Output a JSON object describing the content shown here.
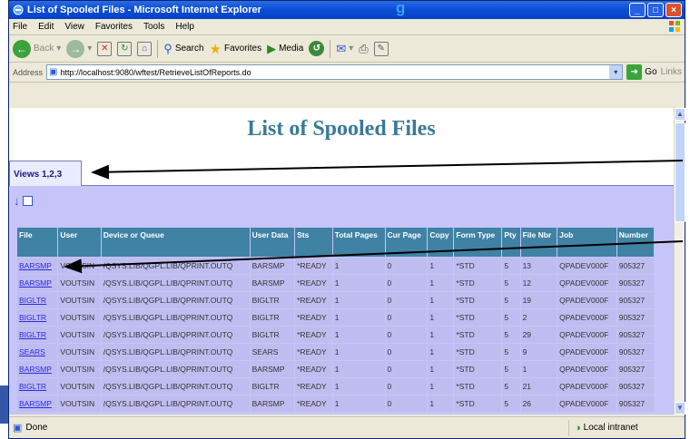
{
  "behind_title_fragment": "g",
  "window": {
    "title": "List of Spooled Files - Microsoft Internet Explorer",
    "buttons": {
      "minimize": "_",
      "maximize": "□",
      "close": "×"
    }
  },
  "menu": [
    "File",
    "Edit",
    "View",
    "Favorites",
    "Tools",
    "Help"
  ],
  "toolbar": {
    "back": "Back",
    "search": "Search",
    "favorites": "Favorites",
    "media": "Media"
  },
  "address": {
    "label": "Address",
    "url": "http://localhost:9080/wftest/RetrieveListOfReports.do",
    "go": "Go",
    "links": "Links"
  },
  "page": {
    "title": "List of Spooled Files",
    "tab_label": "Views 1,2,3"
  },
  "table": {
    "headers": [
      "File",
      "User",
      "Device or Queue",
      "User Data",
      "Sts",
      "Total Pages",
      "Cur Page",
      "Copy",
      "Form Type",
      "Pty",
      "File Nbr",
      "Job",
      "Number"
    ],
    "rows": [
      [
        "BARSMP",
        "VOUTSIN",
        "/QSYS.LIB/QGPL.LIB/QPRINT.OUTQ",
        "BARSMP",
        "*READY",
        "1",
        "0",
        "1",
        "*STD",
        "5",
        "13",
        "QPADEV000F",
        "905327"
      ],
      [
        "BARSMP",
        "VOUTSIN",
        "/QSYS.LIB/QGPL.LIB/QPRINT.OUTQ",
        "BARSMP",
        "*READY",
        "1",
        "0",
        "1",
        "*STD",
        "5",
        "12",
        "QPADEV000F",
        "905327"
      ],
      [
        "BIGLTR",
        "VOUTSIN",
        "/QSYS.LIB/QGPL.LIB/QPRINT.OUTQ",
        "BIGLTR",
        "*READY",
        "1",
        "0",
        "1",
        "*STD",
        "5",
        "19",
        "QPADEV000F",
        "905327"
      ],
      [
        "BIGLTR",
        "VOUTSIN",
        "/QSYS.LIB/QGPL.LIB/QPRINT.OUTQ",
        "BIGLTR",
        "*READY",
        "1",
        "0",
        "1",
        "*STD",
        "5",
        "2",
        "QPADEV000F",
        "905327"
      ],
      [
        "BIGLTR",
        "VOUTSIN",
        "/QSYS.LIB/QGPL.LIB/QPRINT.OUTQ",
        "BIGLTR",
        "*READY",
        "1",
        "0",
        "1",
        "*STD",
        "5",
        "29",
        "QPADEV000F",
        "905327"
      ],
      [
        "SEARS",
        "VOUTSIN",
        "/QSYS.LIB/QGPL.LIB/QPRINT.OUTQ",
        "SEARS",
        "*READY",
        "1",
        "0",
        "1",
        "*STD",
        "5",
        "9",
        "QPADEV000F",
        "905327"
      ],
      [
        "BARSMP",
        "VOUTSIN",
        "/QSYS.LIB/QGPL.LIB/QPRINT.OUTQ",
        "BARSMP",
        "*READY",
        "1",
        "0",
        "1",
        "*STD",
        "5",
        "1",
        "QPADEV000F",
        "905327"
      ],
      [
        "BIGLTR",
        "VOUTSIN",
        "/QSYS.LIB/QGPL.LIB/QPRINT.OUTQ",
        "BIGLTR",
        "*READY",
        "1",
        "0",
        "1",
        "*STD",
        "5",
        "21",
        "QPADEV000F",
        "905327"
      ],
      [
        "BARSMP",
        "VOUTSIN",
        "/QSYS.LIB/QGPL.LIB/QPRINT.OUTQ",
        "BARSMP",
        "*READY",
        "1",
        "0",
        "1",
        "*STD",
        "5",
        "26",
        "QPADEV000F",
        "905327"
      ]
    ]
  },
  "status": {
    "text": "Done",
    "zone": "Local intranet"
  },
  "colors": {
    "title_bar": "#0a4fd6",
    "page_title": "#3a7a98",
    "panel_bg": "#c6c4f8",
    "header_bg": "#3f82a4",
    "link": "#2a2ae0"
  }
}
